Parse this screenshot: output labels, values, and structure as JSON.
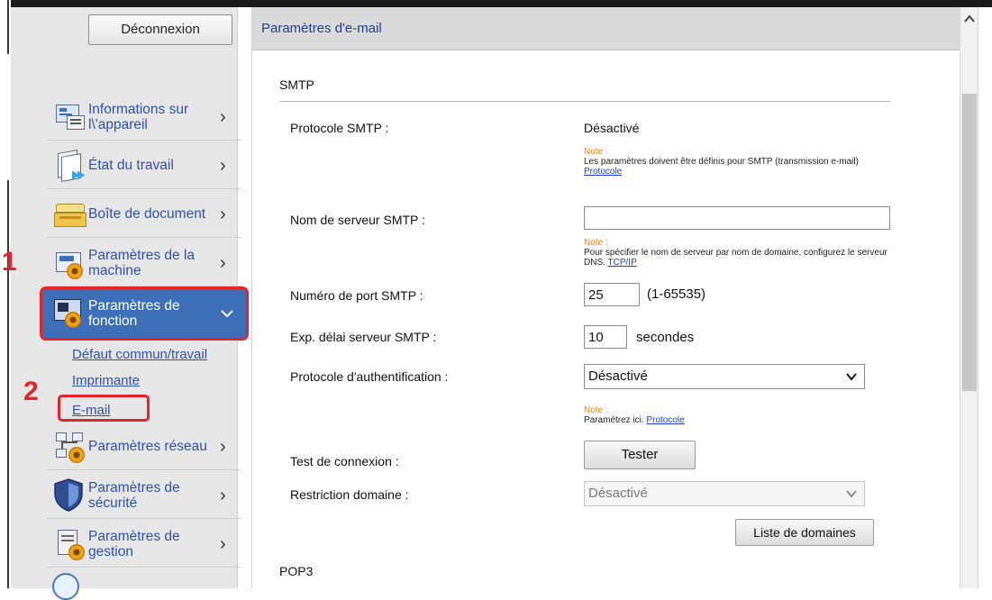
{
  "sidebar": {
    "logout_label": "Déconnexion",
    "items": [
      {
        "label": "Informations sur l\\'appareil",
        "icon": "device-info-icon"
      },
      {
        "label": "État du travail",
        "icon": "job-status-icon"
      },
      {
        "label": "Boîte de document",
        "icon": "document-box-icon"
      },
      {
        "label": "Paramètres de la machine",
        "icon": "machine-settings-icon"
      },
      {
        "label": "Paramètres de fonction",
        "icon": "function-settings-icon"
      },
      {
        "label": "Paramètres réseau",
        "icon": "network-settings-icon"
      },
      {
        "label": "Paramètres de sécurité",
        "icon": "security-settings-icon"
      },
      {
        "label": "Paramètres de gestion",
        "icon": "management-settings-icon"
      }
    ],
    "sublinks": [
      "Défaut commun/travail",
      "Imprimante",
      "E-mail"
    ],
    "step1": "1",
    "step2": "2"
  },
  "main": {
    "title": "Paramètres d'e-mail",
    "smtp_section": "SMTP",
    "pop3_section": "POP3",
    "rows": {
      "protocol_label": "Protocole SMTP :",
      "protocol_value": "Désactivé",
      "server_label": "Nom de serveur SMTP :",
      "server_value": "",
      "port_label": "Numéro de port SMTP :",
      "port_value": "25",
      "port_range": "(1-65535)",
      "timeout_label": "Exp. délai serveur SMTP :",
      "timeout_value": "10",
      "timeout_unit": "secondes",
      "auth_label": "Protocole d'authentification :",
      "auth_value": "Désactivé",
      "test_label": "Test de connexion :",
      "test_button": "Tester",
      "domain_label": "Restriction domaine :",
      "domain_value": "Désactivé",
      "domain_list_button": "Liste de domaines"
    },
    "notes": {
      "prefix": "Note :",
      "note1_text": "Les paramètres doivent être définis pour SMTP (transmission e-mail)",
      "note1_link": "Protocole",
      "note2_text": "Pour spécifier le nom de serveur par nom de domaine, configurez le serveur DNS.",
      "note2_link": "TCP/IP",
      "note3_text": "Paramétrez ici.",
      "note3_link": "Protocole"
    }
  },
  "colors": {
    "accent_active": "#3d6fb6",
    "highlight_red": "#e2252b",
    "link_blue": "#2e52a3",
    "note_orange": "#f08200"
  }
}
